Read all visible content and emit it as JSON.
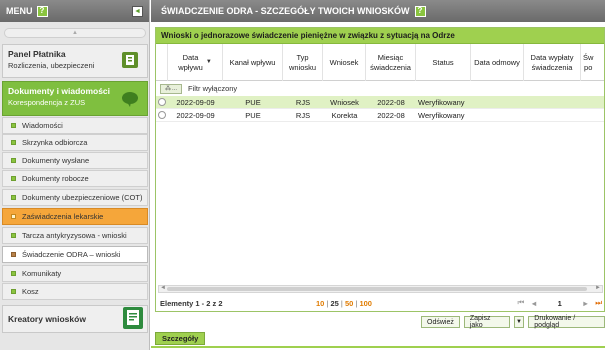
{
  "menu": {
    "title": "MENU",
    "help": "?",
    "collapse": "◄",
    "panel_platnika": {
      "title": "Panel Płatnika",
      "sub": "Rozliczenia, ubezpieczeni"
    },
    "dokumenty": {
      "title": "Dokumenty i wiadomości",
      "sub": "Korespondencja z ZUS"
    },
    "items": [
      "Wiadomości",
      "Skrzynka odbiorcza",
      "Dokumenty wysłane",
      "Dokumenty robocze",
      "Dokumenty ubezpieczeniowe (COT)",
      "Zaświadczenia lekarskie",
      "Tarcza antykryzysowa - wnioski",
      "Świadczenie ODRA – wnioski",
      "Komunikaty",
      "Kosz"
    ],
    "creators": "Kreatory wniosków",
    "colors": {
      "accent_green": "#7fbf3f",
      "highlight_orange": "#f5a63a"
    }
  },
  "main": {
    "title": "ŚWIADCZENIE ODRA - SZCZEGÓŁY TWOICH WNIOSKÓW",
    "help": "?",
    "grid_title": "Wnioski o jednorazowe świadczenie pieniężne w związku z sytuacją na Odrze",
    "columns": [
      "Data\nwpływu",
      "Kanał wpływu",
      "Typ\nwniosku",
      "Wniosek",
      "Miesiąc\nświadczenia",
      "Status",
      "Data odmowy",
      "Data wypłaty\nświadczenia",
      "Św\npo"
    ],
    "sort_arrow": "▼",
    "filter_label": "Filtr wyłączony",
    "filter_button": "...",
    "rows": [
      {
        "data": "2022-09-09",
        "kanal": "PUE",
        "typ": "RJS",
        "wniosek": "Wniosek",
        "miesiac": "2022-08",
        "status": "Weryfikowany",
        "odmowa": "",
        "wyplata": ""
      },
      {
        "data": "2022-09-09",
        "kanal": "PUE",
        "typ": "RJS",
        "wniosek": "Korekta",
        "miesiac": "2022-08",
        "status": "Weryfikowany",
        "odmowa": "",
        "wyplata": ""
      }
    ],
    "elements": "Elementy 1 - 2 z 2",
    "page_sizes": [
      "10",
      "25",
      "50",
      "100"
    ],
    "page_number": "1",
    "buttons": {
      "refresh": "Odśwież",
      "save_as": "Zapisz jako",
      "save_caret": "▼",
      "print": "Drukowanie / podgląd"
    },
    "details_tab": "Szczegóły"
  }
}
